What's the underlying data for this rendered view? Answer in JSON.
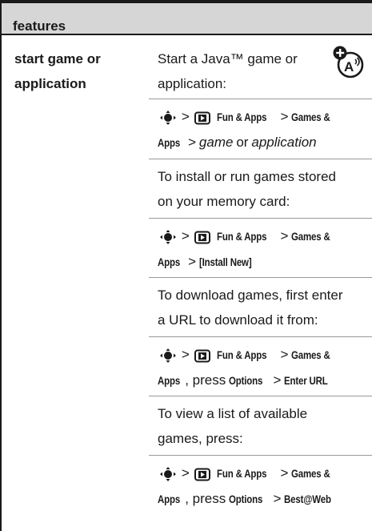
{
  "header": {
    "title": "features"
  },
  "feature": {
    "name_line1": "start game or",
    "name_line2": "application"
  },
  "icons": {
    "java": "java-app-icon",
    "nav": "nav-key-icon",
    "apps": "fun-apps-icon"
  },
  "steps": [
    {
      "text1": "Start a Java™ game or",
      "text2": "application:"
    },
    {
      "text1": "To install or run games stored",
      "text2": "on your memory card:"
    },
    {
      "text1": "To download games, first enter",
      "text2": "a URL to download it from:"
    },
    {
      "text1": "To view a list of available",
      "text2": "games, press:"
    }
  ],
  "paths": {
    "gt": ">",
    "fun_apps": "Fun & Apps",
    "games_1": "Games &",
    "games_2": "Apps",
    "or": "or",
    "game": "game",
    "application": "application",
    "install_new": "[Install New]",
    "press": ", press",
    "options": "Options",
    "enter_url": "Enter URL",
    "best_web": "Best@Web"
  }
}
